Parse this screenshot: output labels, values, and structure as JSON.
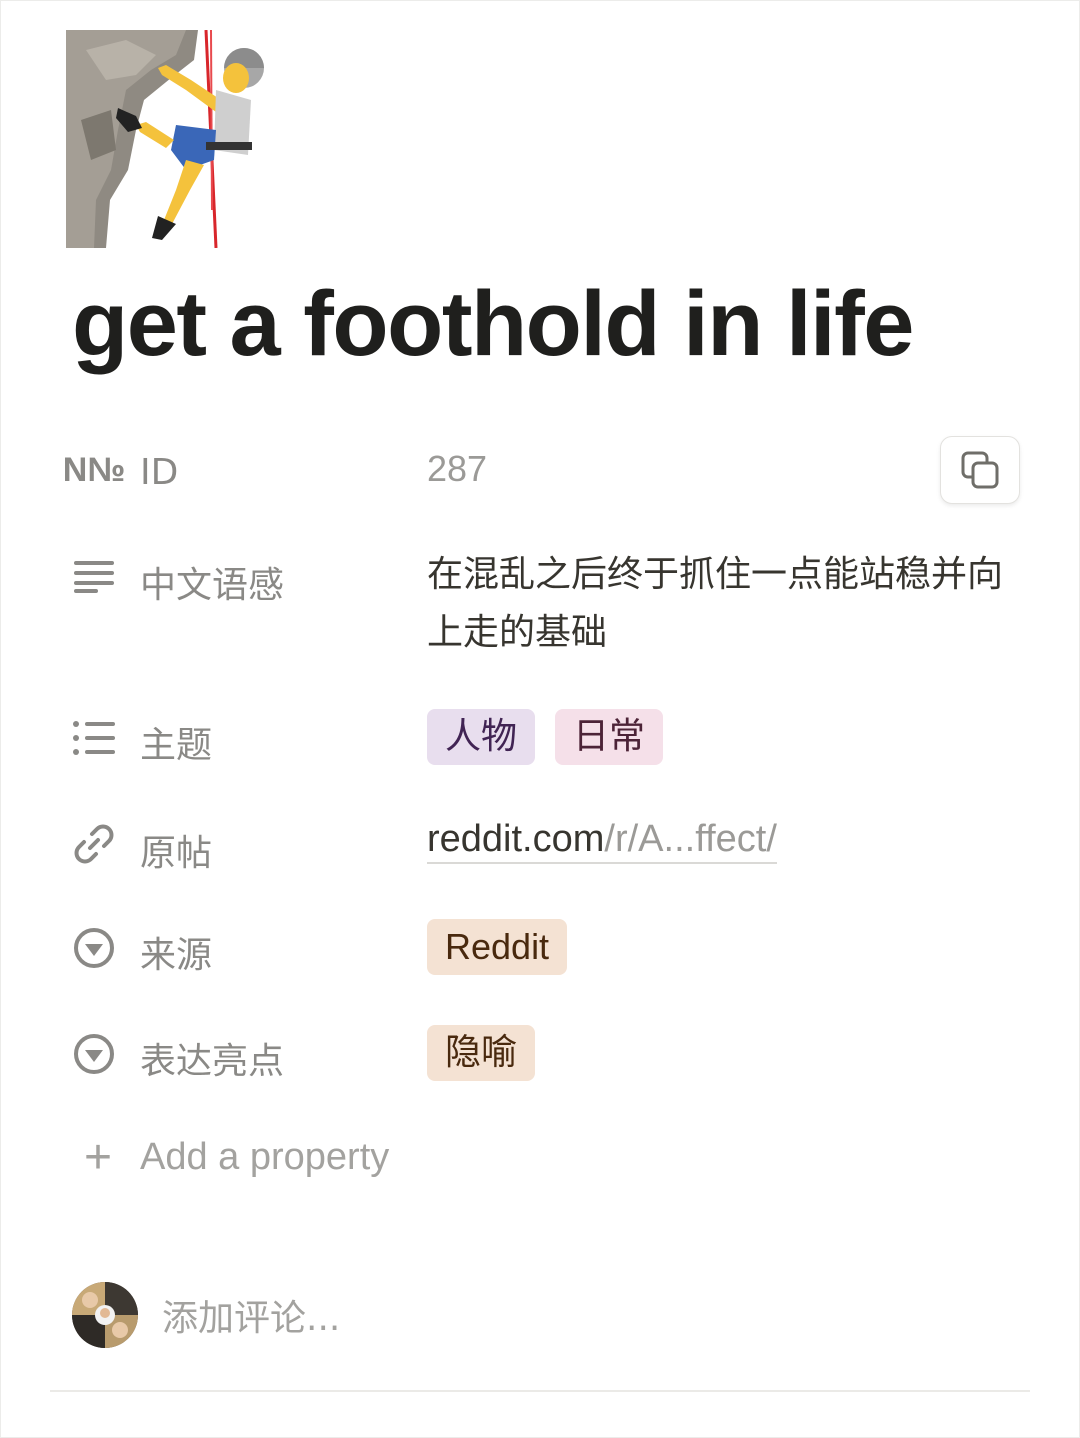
{
  "page": {
    "icon": "person-climbing-emoji",
    "title": "get a foothold in life"
  },
  "properties": [
    {
      "icon": "number-icon",
      "icon_text": "N№",
      "label": "ID",
      "value": "287"
    },
    {
      "icon": "text-lines-icon",
      "label": "中文语感",
      "value": "在混乱之后终于抓住一点能站稳并向上走的基础"
    },
    {
      "icon": "multi-select-list-icon",
      "label": "主题",
      "tags": [
        {
          "text": "人物",
          "bg": "#e8deee",
          "color": "#412454"
        },
        {
          "text": "日常",
          "bg": "#f5e0e9",
          "color": "#4c2337"
        }
      ]
    },
    {
      "icon": "link-icon",
      "label": "原帖",
      "link_domain": "reddit.com",
      "link_path": "/r/A...ffect/"
    },
    {
      "icon": "select-icon",
      "label": "来源",
      "tags": [
        {
          "text": "Reddit",
          "bg": "#f4e2d3",
          "color": "#49290e"
        }
      ]
    },
    {
      "icon": "select-icon",
      "label": "表达亮点",
      "tags": [
        {
          "text": "隐喻",
          "bg": "#f4e2d3",
          "color": "#49290e"
        }
      ]
    }
  ],
  "add_property": {
    "icon": "plus-icon",
    "label": "Add a property"
  },
  "copy_button": {
    "icon": "copy-icon"
  },
  "comment": {
    "avatar": "user-avatar",
    "placeholder": "添加评论..."
  }
}
